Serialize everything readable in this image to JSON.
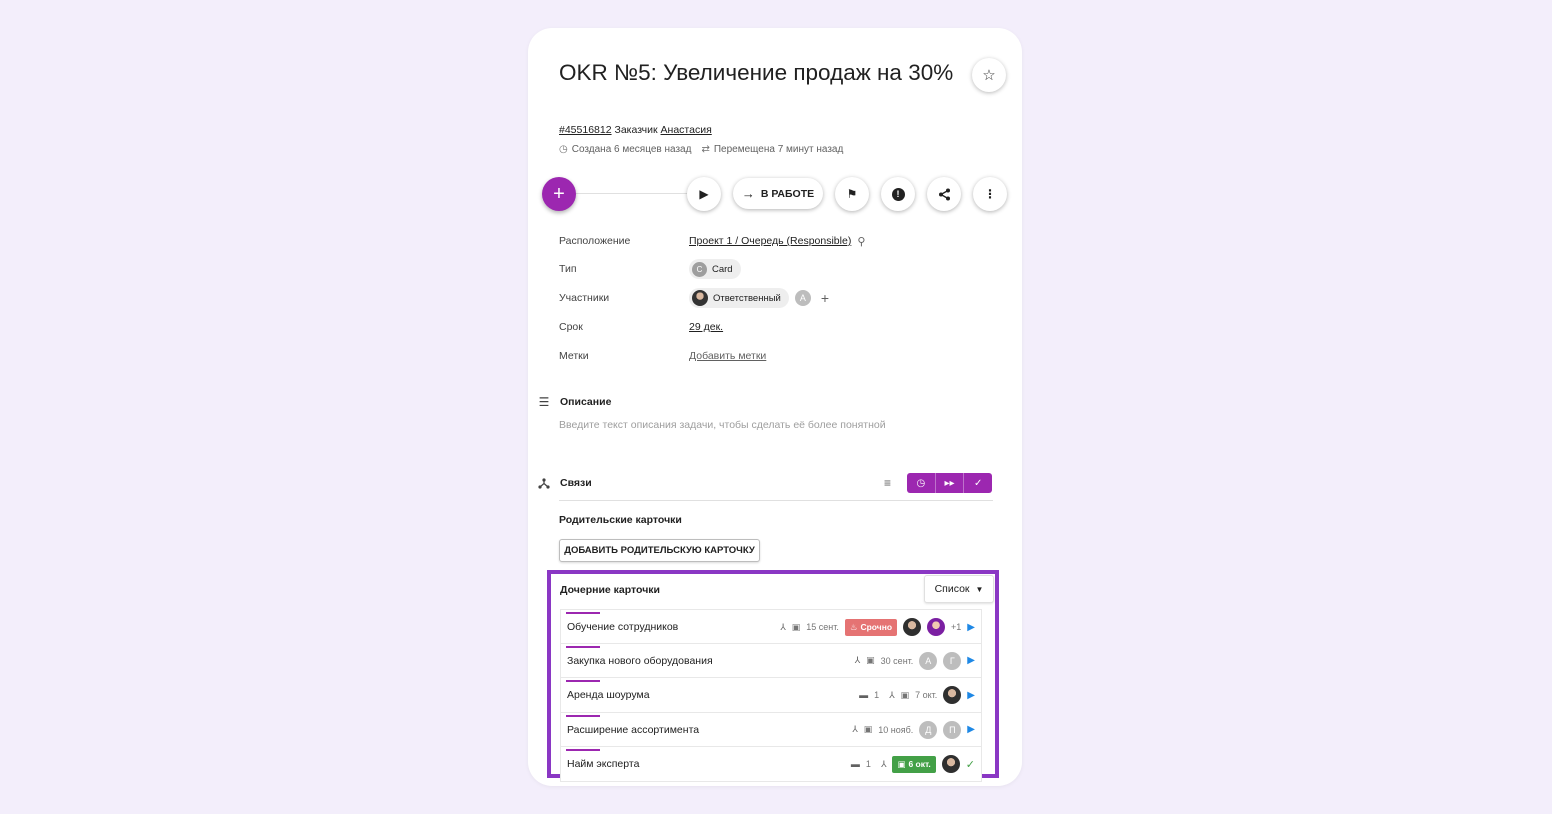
{
  "task": {
    "title": "OKR №5: Увеличение продаж на 30%",
    "id": "#45516812",
    "customer_label": "Заказчик",
    "customer_name": "Анастасия",
    "created": "Создана 6 месяцев назад",
    "moved": "Перемещена 7 минут назад"
  },
  "toolbar": {
    "fab_label": "+",
    "status_label": "В РАБОТЕ"
  },
  "properties": {
    "location_label": "Расположение",
    "location_value": "Проект 1 / Очередь (Responsible)",
    "type_label": "Тип",
    "type_chip_letter": "C",
    "type_value": "Card",
    "members_label": "Участники",
    "member_chip": "Ответственный",
    "member_extra_letter": "А",
    "due_label": "Срок",
    "due_value": "29 дек.",
    "tags_label": "Метки",
    "tags_value": "Добавить метки"
  },
  "description": {
    "heading": "Описание",
    "placeholder": "Введите текст описания задачи, чтобы сделать её более понятной"
  },
  "links": {
    "heading": "Связи",
    "parent_title": "Родительские карточки",
    "add_parent_button": "ДОБАВИТЬ РОДИТЕЛЬСКУЮ КАРТОЧКУ",
    "children_title": "Дочерние карточки",
    "view_select": "Список",
    "children": [
      {
        "name": "Обучение сотрудников",
        "date": "15 сент.",
        "badge": "Срочно",
        "extra": "+1"
      },
      {
        "name": "Закупка нового оборудования",
        "date": "30 сент.",
        "a1": "А",
        "a2": "Г"
      },
      {
        "name": "Аренда шоурума",
        "comments": "1",
        "date": "7 окт."
      },
      {
        "name": "Расширение ассортимента",
        "date": "10 нояб.",
        "a1": "Д",
        "a2": "П"
      },
      {
        "name": "Найм эксперта",
        "comments": "1",
        "date": "6 окт."
      }
    ]
  },
  "colors": {
    "accent": "#9c27b0",
    "highlight_border": "#8a37c4",
    "urgent": "#e57373",
    "done": "#43a047",
    "play": "#1e88e5"
  }
}
